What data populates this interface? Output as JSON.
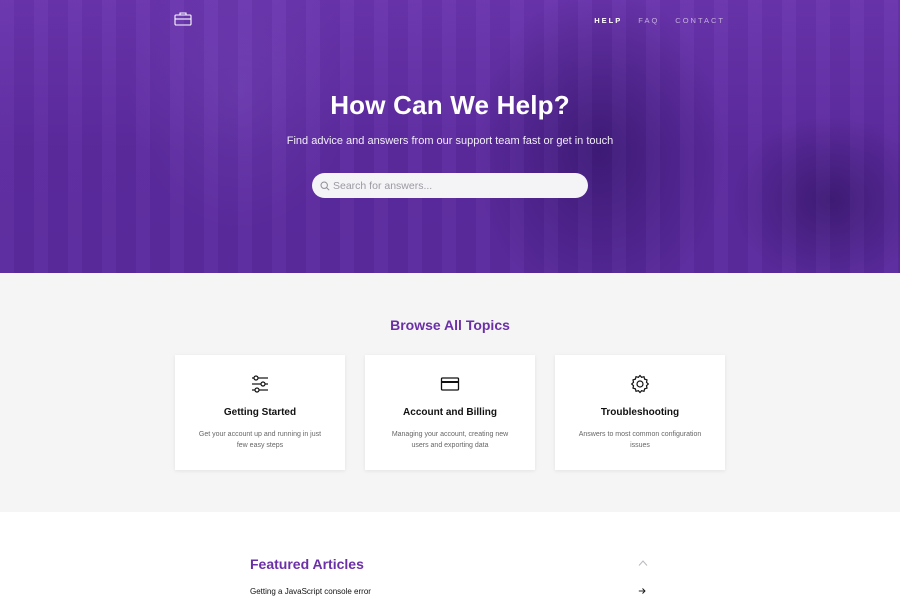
{
  "nav": {
    "logo_icon": "briefcase-icon",
    "items": [
      {
        "label": "HELP",
        "active": true
      },
      {
        "label": "FAQ",
        "active": false
      },
      {
        "label": "CONTACT",
        "active": false
      }
    ]
  },
  "hero": {
    "title": "How Can We Help?",
    "subtitle": "Find advice and answers from our support team fast or get in touch",
    "search": {
      "placeholder": "Search for answers...",
      "value": "",
      "icon": "search-icon"
    }
  },
  "topics": {
    "title": "Browse All Topics",
    "cards": [
      {
        "icon": "sliders-icon",
        "title": "Getting Started",
        "description": "Get your account up and running in just few easy steps"
      },
      {
        "icon": "credit-card-icon",
        "title": "Account and Billing",
        "description": "Managing your account, creating new users and exporting data"
      },
      {
        "icon": "gear-icon",
        "title": "Troubleshooting",
        "description": "Answers to most common configuration issues"
      }
    ]
  },
  "featured": {
    "title": "Featured Articles",
    "collapse_icon": "chevron-up-icon",
    "articles": [
      {
        "title": "Getting a JavaScript console error",
        "icon": "arrow-right-icon"
      }
    ]
  },
  "colors": {
    "accent": "#6b2fa6",
    "hero_bg": "#5c2a9f",
    "section_bg": "#f5f5f5"
  }
}
